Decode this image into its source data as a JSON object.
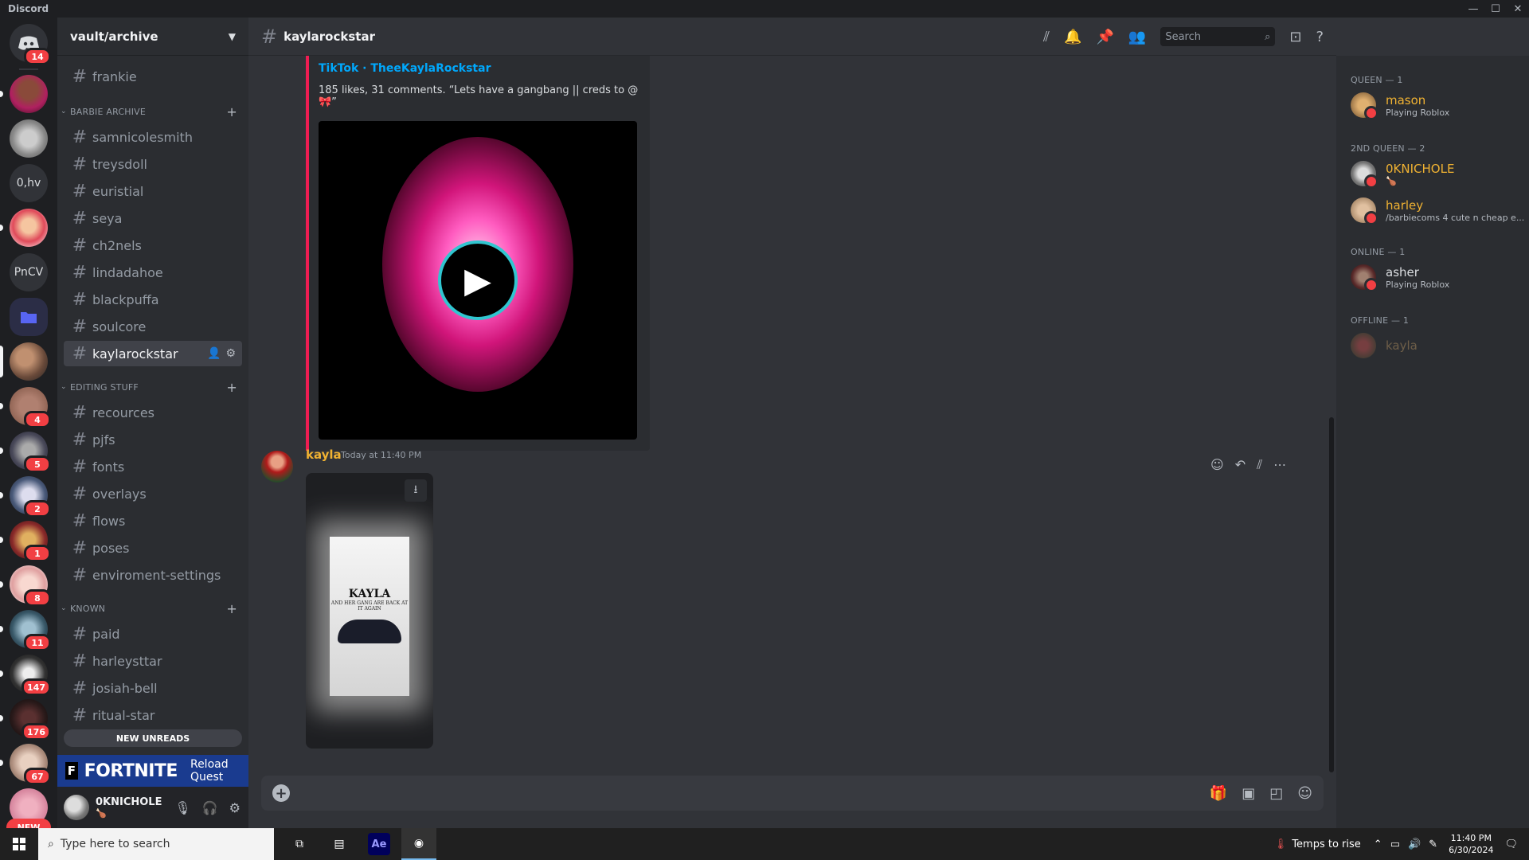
{
  "app": {
    "title": "Discord"
  },
  "window_controls": [
    "—",
    "☐",
    "✕"
  ],
  "servers": [
    {
      "name": "discord-home",
      "badge": "14"
    },
    {
      "name": "server-1",
      "badge": ""
    },
    {
      "name": "server-2",
      "badge": ""
    },
    {
      "name": "server-0hv",
      "text": "0,hv",
      "badge": ""
    },
    {
      "name": "server-4",
      "badge": ""
    },
    {
      "name": "server-pncv",
      "text": "PnCV",
      "badge": ""
    },
    {
      "name": "folder",
      "badge": ""
    },
    {
      "name": "vault-archive",
      "badge": ""
    },
    {
      "name": "server-8",
      "badge": "4"
    },
    {
      "name": "server-9",
      "badge": "5"
    },
    {
      "name": "server-10",
      "badge": "2"
    },
    {
      "name": "server-11",
      "badge": "1"
    },
    {
      "name": "server-12",
      "badge": "8"
    },
    {
      "name": "server-13",
      "badge": "11"
    },
    {
      "name": "server-14",
      "badge": "147"
    },
    {
      "name": "server-15",
      "badge": "176"
    },
    {
      "name": "server-16",
      "badge": "67"
    }
  ],
  "new_label": "NEW",
  "guild": {
    "name": "vault/archive"
  },
  "channels_top": [
    "frankie"
  ],
  "categories": [
    {
      "name": "BARBIE ARCHIVE",
      "channels": [
        "samnicolesmith",
        "treysdoll",
        "euristial",
        "seya",
        "ch2nels",
        "lindadahoe",
        "blackpuffa",
        "soulcore",
        "kaylarockstar"
      ]
    },
    {
      "name": "EDITING STUFF",
      "channels": [
        "recources",
        "pjfs",
        "fonts",
        "overlays",
        "flows",
        "poses",
        "enviroment-settings"
      ]
    },
    {
      "name": "KNOWN",
      "channels": [
        "paid",
        "harleysttar",
        "josiah-bell",
        "ritual-star"
      ]
    }
  ],
  "new_unreads": "NEW UNREADS",
  "quest": {
    "brand": "FORTNITE",
    "label": "Reload Quest"
  },
  "user": {
    "name": "0KNICHOLE",
    "status": "🍗"
  },
  "channel_header": {
    "title": "kaylarockstar",
    "search_placeholder": "Search"
  },
  "embed": {
    "site": "TikTok · TheeKaylaRockstar",
    "description": "185 likes, 31 comments. “Lets have a gangbang || creds to @ 🎀”"
  },
  "message": {
    "author": "kayla",
    "timestamp": "Today at 11:40 PM",
    "attachment": {
      "title": "KAYLA",
      "subtitle": "AND HER GANG ARE BACK AT IT AGAIN"
    }
  },
  "member_groups": [
    {
      "label": "QUEEN — 1",
      "members": [
        {
          "name": "mason",
          "activity": "Playing Roblox",
          "color": "#f0b232"
        }
      ]
    },
    {
      "label": "2ND QUEEN — 2",
      "members": [
        {
          "name": "0KNICHOLE",
          "activity": "🍗",
          "color": "#f0b232"
        },
        {
          "name": "harley",
          "activity": "/barbiecoms 4 cute n cheap e...",
          "color": "#f0b232"
        }
      ]
    },
    {
      "label": "ONLINE — 1",
      "members": [
        {
          "name": "asher",
          "activity": "Playing Roblox",
          "color": "#dbdee1"
        }
      ]
    },
    {
      "label": "OFFLINE — 1",
      "members": [
        {
          "name": "kayla",
          "activity": "",
          "color": "#6b5a3a"
        }
      ]
    }
  ],
  "taskbar": {
    "search_placeholder": "Type here to search",
    "weather": "Temps to rise",
    "time": "11:40 PM",
    "date": "6/30/2024"
  }
}
